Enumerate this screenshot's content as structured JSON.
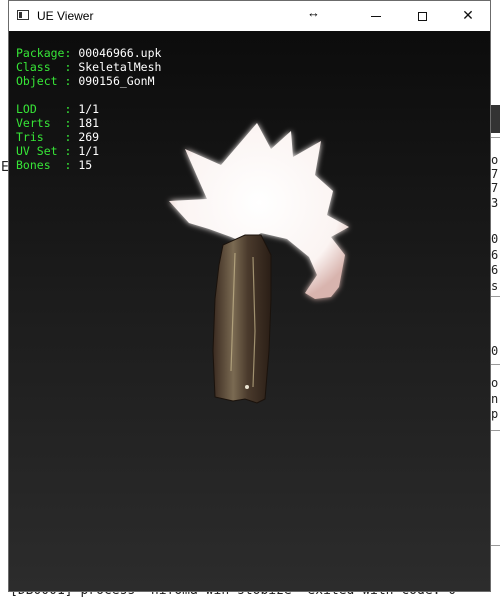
{
  "window": {
    "title": "UE Viewer",
    "resize_icon": "↔",
    "controls": {
      "minimize": "minimize-icon",
      "maximize": "maximize-icon",
      "close": "✕"
    }
  },
  "info": {
    "package_key": "Package:",
    "package": "00046966.upk",
    "class_key": "Class  :",
    "class": "SkeletalMesh",
    "object_key": "Object :",
    "object": "090156_GonM",
    "lod_key": "LOD    :",
    "lod": "1/1",
    "verts_key": "Verts  :",
    "verts": "181",
    "tris_key": "Tris   :",
    "tris": "269",
    "uvset_key": "UV Set :",
    "uvset": "1/1",
    "bones_key": "Bones  :",
    "bones": "15"
  },
  "background_console": {
    "left_char": "E",
    "right_column": [
      "o",
      "7",
      "7",
      "3",
      "0",
      "6",
      "6",
      "s",
      "0",
      "o",
      "n",
      "p"
    ],
    "bottom_line": "[DB0001] process  nifoma win stobize  exited with code: 0"
  },
  "colors": {
    "info_key": "#37e637",
    "info_value": "#ffffff"
  }
}
